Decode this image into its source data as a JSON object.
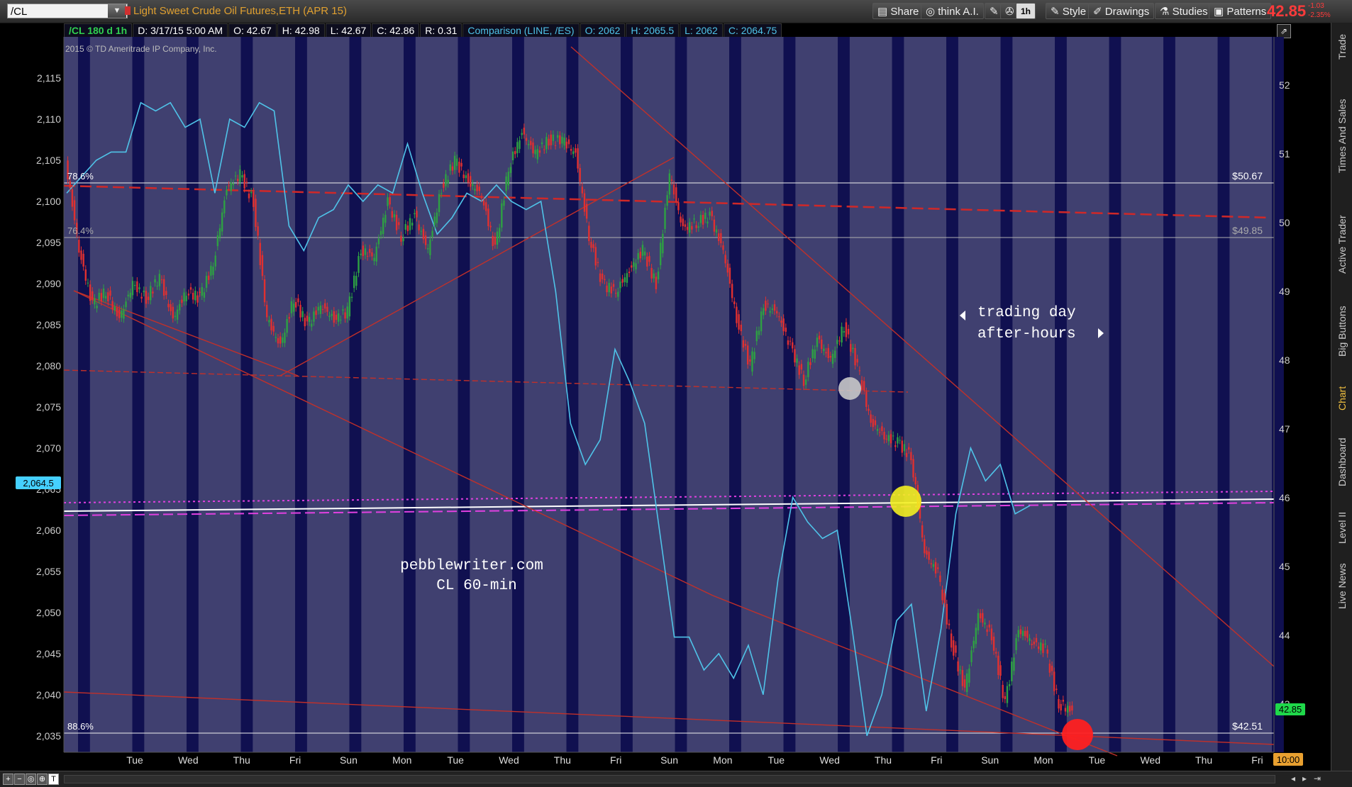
{
  "toolbar": {
    "symbol": "/CL",
    "description": "Light Sweet Crude Oil Futures,ETH (APR 15)",
    "share": "Share",
    "think_ai": "think A.I.",
    "interval": "1h",
    "style": "Style",
    "drawings": "Drawings",
    "studies": "Studies",
    "patterns": "Patterns",
    "last_price": "42.85",
    "change": "-1.03",
    "change_pct": "-2.35%"
  },
  "infobar": {
    "chart_id": "/CL 180 d 1h",
    "date": "D: 3/17/15 5:00 AM",
    "open": "O: 42.67",
    "high": "H: 42.98",
    "low": "L: 42.67",
    "close": "C: 42.86",
    "range": "R: 0.31",
    "comparison": "Comparison (LINE, /ES)",
    "cmp_open": "O: 2062",
    "cmp_high": "H: 2065.5",
    "cmp_low": "L: 2062",
    "cmp_close": "C: 2064.75"
  },
  "copyright": "2015 © TD Ameritrade IP Company, Inc.",
  "side_tabs": [
    "Trade",
    "Times And Sales",
    "Active Trader",
    "Big Buttons",
    "Chart",
    "Dashboard",
    "Level II",
    "Live News"
  ],
  "annotations": {
    "watermark_line1": "pebblewriter.com",
    "watermark_line2": "CL 60-min",
    "legend_trading": "trading day",
    "legend_afterhours": "after-hours"
  },
  "fib_labels": {
    "fib_786": "78.6%",
    "fib_764": "76.4%",
    "fib_886": "88.6%",
    "price_5067": "$50.67",
    "price_4985": "$49.85",
    "price_4251": "$42.51"
  },
  "time_label": "10:00",
  "colors": {
    "background_session": "#404070",
    "background_afterhours": "#101050",
    "price_up": "#2ea043",
    "price_down": "#e03030",
    "comparison_line": "#4fc3e8",
    "trendline": "#c0302a",
    "magenta": "#e040e0",
    "last_price": "#ff3b3b"
  },
  "chart_data": {
    "type": "line",
    "x_ticks": [
      "Tue",
      "Wed",
      "Thu",
      "Fri",
      "Sun",
      "Mon",
      "Tue",
      "Wed",
      "Thu",
      "Fri",
      "Sun",
      "Mon",
      "Tue",
      "Wed",
      "Thu",
      "Fri",
      "Sun",
      "Mon",
      "Tue",
      "Wed",
      "Thu",
      "Fri"
    ],
    "left_axis_ticks": [
      "2,115",
      "2,110",
      "2,105",
      "2,100",
      "2,095",
      "2,090",
      "2,085",
      "2,080",
      "2,075",
      "2,070",
      "2,065",
      "2,060",
      "2,055",
      "2,050",
      "2,045",
      "2,040",
      "2,035"
    ],
    "left_axis_marker": "2,064.5",
    "right_axis_ticks": [
      "52",
      "51",
      "50",
      "49",
      "48",
      "47",
      "46",
      "45",
      "44",
      "43"
    ],
    "right_axis_marker": "42.85",
    "left_ylim": [
      2033,
      2120
    ],
    "right_ylim": [
      42.3,
      52.7
    ],
    "series": [
      {
        "name": "/CL",
        "axis": "right",
        "values": [
          50.9,
          49.6,
          48.8,
          49.0,
          48.6,
          49.1,
          48.9,
          49.2,
          48.6,
          49.0,
          48.9,
          49.4,
          50.5,
          50.7,
          50.3,
          48.6,
          48.2,
          48.9,
          48.5,
          48.8,
          48.6,
          48.7,
          49.6,
          49.5,
          50.3,
          49.8,
          50.1,
          49.6,
          50.5,
          50.9,
          50.6,
          50.4,
          49.6,
          50.8,
          51.3,
          51.0,
          51.2,
          51.2,
          51.0,
          49.8,
          49.1,
          49.0,
          49.3,
          49.6,
          49.1,
          50.7,
          49.9,
          50.0,
          50.1,
          49.6,
          48.6,
          47.9,
          48.8,
          48.7,
          48.2,
          47.7,
          48.3,
          48.0,
          48.5,
          47.9,
          47.1,
          46.9,
          46.8,
          46.6,
          45.2,
          44.9,
          43.9,
          43.2,
          44.3,
          44.0,
          43.0,
          44.1,
          43.9,
          43.8,
          43.0,
          42.9
        ]
      },
      {
        "name": "/ES",
        "axis": "left",
        "values": [
          2101,
          2103,
          2105,
          2106,
          2106,
          2112,
          2111,
          2112,
          2109,
          2110,
          2101,
          2110,
          2109,
          2112,
          2111,
          2097,
          2094,
          2098,
          2099,
          2102,
          2100,
          2102,
          2101,
          2107,
          2101,
          2096,
          2098,
          2101,
          2100,
          2102,
          2100,
          2099,
          2100,
          2089,
          2073,
          2068,
          2071,
          2082,
          2078,
          2073,
          2060,
          2047,
          2047,
          2043,
          2045,
          2042,
          2046,
          2040,
          2054,
          2064,
          2061,
          2059,
          2060,
          2048,
          2035,
          2040,
          2049,
          2051,
          2038,
          2048,
          2062,
          2070,
          2066,
          2068,
          2062,
          2063
        ]
      }
    ]
  }
}
